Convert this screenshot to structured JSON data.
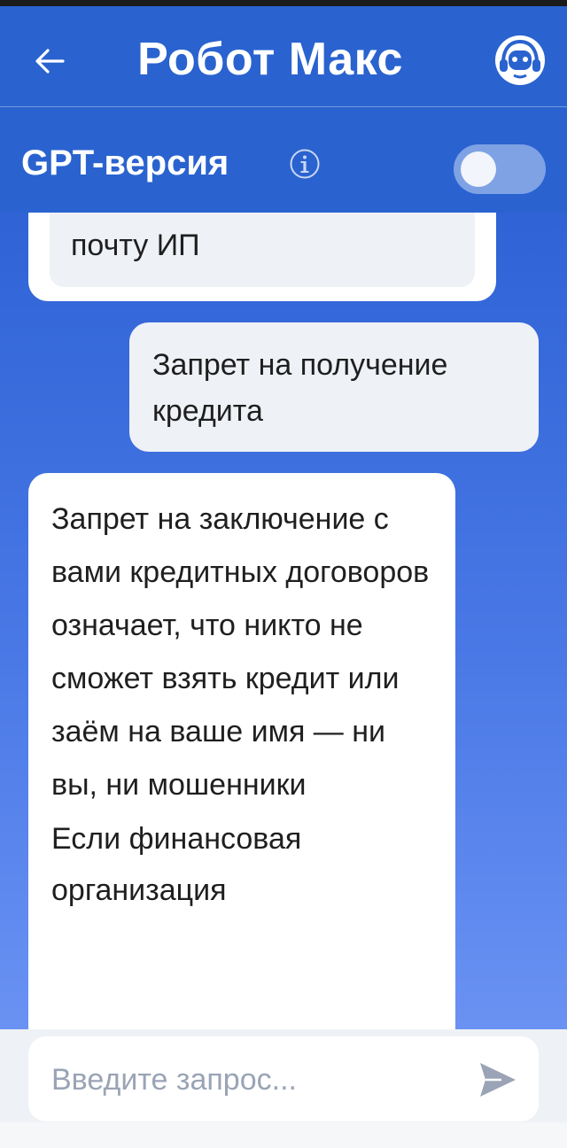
{
  "header": {
    "title": "Робот Макс",
    "gpt_label": "GPT-версия",
    "toggle_on": false
  },
  "messages": {
    "prev_bot_tail": "почту ИП",
    "user": "Запрет на получение кредита",
    "bot_paragraph_1": "Запрет на заключение с вами кредитных договоров означает, что никто не сможет взять кредит или заём на ваше имя — ни вы, ни мошенники",
    "bot_paragraph_2": "Если финансовая организация"
  },
  "composer": {
    "placeholder": "Введите запрос...",
    "value": ""
  },
  "colors": {
    "header_bg": "#2a63cf",
    "chat_gradient_top": "#2f63d6",
    "chat_gradient_bottom": "#6a92f3",
    "bubble_bg": "#ffffff",
    "user_bubble_bg": "#eef1f6",
    "send_icon": "#9aa4b6"
  },
  "icons": {
    "back": "arrow-left-icon",
    "avatar": "robot-headset-icon",
    "info": "info-icon",
    "send": "send-icon"
  }
}
